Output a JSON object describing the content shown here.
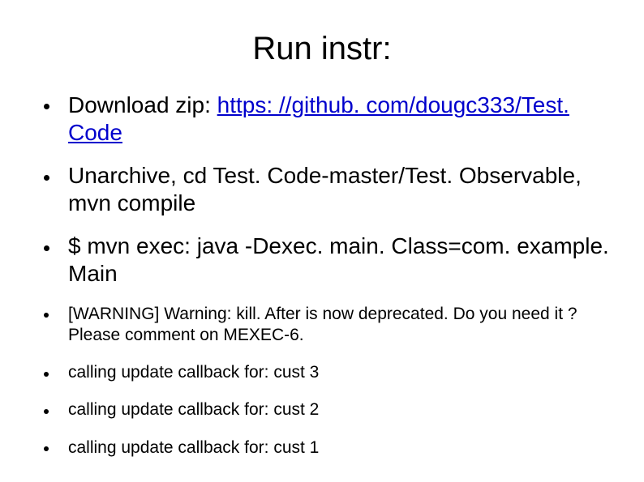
{
  "title": "Run instr:",
  "items": [
    {
      "size": "big",
      "parts": [
        {
          "type": "text",
          "value": "Download zip: "
        },
        {
          "type": "link",
          "value": "https: //github. com/dougc333/Test. Code",
          "href": "https://github.com/dougc333/TestCode"
        }
      ]
    },
    {
      "size": "big",
      "parts": [
        {
          "type": "text",
          "value": "Unarchive, cd Test. Code-master/Test. Observable, mvn compile"
        }
      ]
    },
    {
      "size": "big",
      "parts": [
        {
          "type": "text",
          "value": "$ mvn exec: java -Dexec. main. Class=com. example. Main"
        }
      ]
    },
    {
      "size": "small",
      "parts": [
        {
          "type": "text",
          "value": "[WARNING] Warning: kill. After is now deprecated. Do you need it ? Please comment on MEXEC-6."
        }
      ]
    },
    {
      "size": "small",
      "parts": [
        {
          "type": "text",
          "value": "calling update callback for: cust 3"
        }
      ]
    },
    {
      "size": "small",
      "parts": [
        {
          "type": "text",
          "value": "calling update callback for: cust 2"
        }
      ]
    },
    {
      "size": "small",
      "parts": [
        {
          "type": "text",
          "value": "calling update callback for: cust 1"
        }
      ]
    }
  ]
}
